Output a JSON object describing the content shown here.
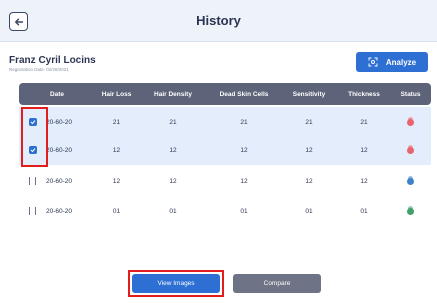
{
  "header": {
    "title": "History"
  },
  "patient": {
    "name": "Franz Cyril Locins",
    "registration": "Registration Date: 02/28/2021"
  },
  "actions": {
    "analyze_label": "Analyze",
    "view_images_label": "View Images",
    "compare_label": "Compare"
  },
  "table": {
    "columns": [
      "Date",
      "Hair Loss",
      "Hair Density",
      "Dead Skin Cells",
      "Sensitivity",
      "Thickness",
      "Status"
    ],
    "rows": [
      {
        "date": "20-60-20",
        "hair_loss": "21",
        "hair_density": "21",
        "dead_skin_cells": "21",
        "sensitivity": "21",
        "thickness": "21",
        "checked": true,
        "status_color": "#e8646e"
      },
      {
        "date": "20-60-20",
        "hair_loss": "12",
        "hair_density": "12",
        "dead_skin_cells": "12",
        "sensitivity": "12",
        "thickness": "12",
        "checked": true,
        "status_color": "#e8646e"
      },
      {
        "date": "20-60-20",
        "hair_loss": "12",
        "hair_density": "12",
        "dead_skin_cells": "12",
        "sensitivity": "12",
        "thickness": "12",
        "checked": false,
        "status_color": "#3f82c9"
      },
      {
        "date": "20-60-20",
        "hair_loss": "01",
        "hair_density": "01",
        "dead_skin_cells": "01",
        "sensitivity": "01",
        "thickness": "01",
        "checked": false,
        "status_color": "#3fa06c"
      }
    ]
  },
  "colors": {
    "accent": "#2d6fd3",
    "highlight": "#e11d1d",
    "header_bg": "#5d6479",
    "selected_row": "#e3edfc"
  }
}
